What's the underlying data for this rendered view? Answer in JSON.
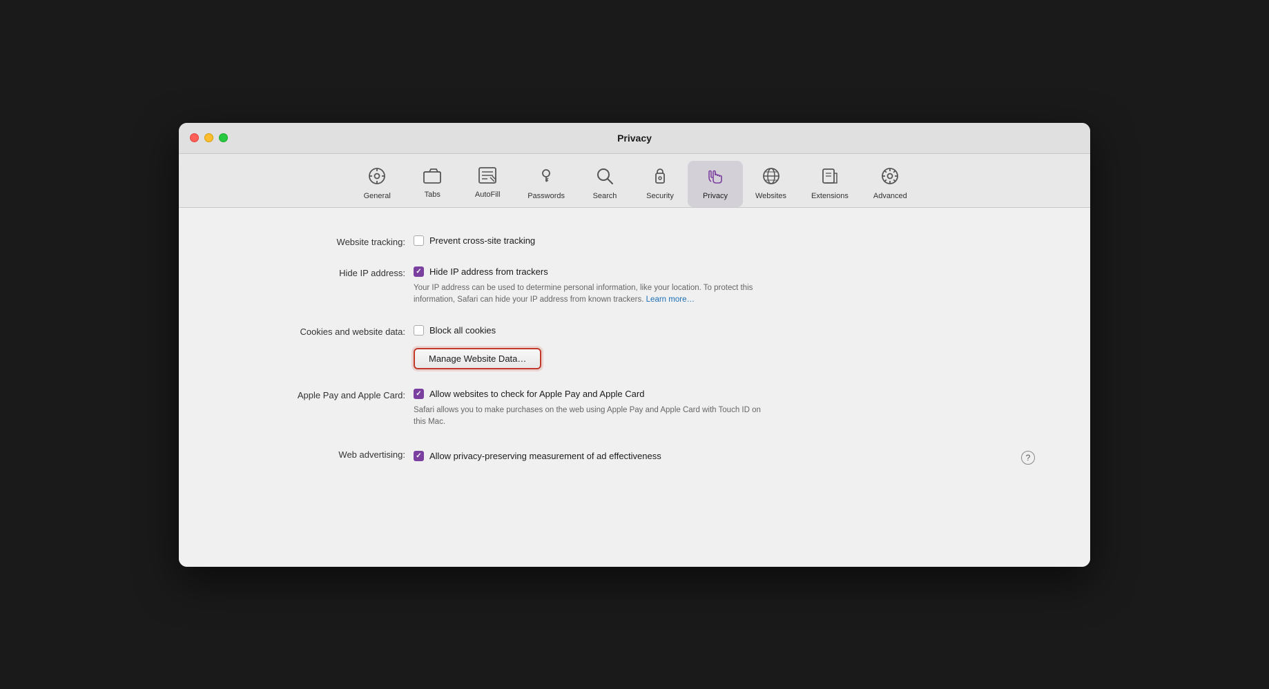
{
  "window": {
    "title": "Privacy"
  },
  "toolbar": {
    "items": [
      {
        "id": "general",
        "label": "General",
        "icon": "⚙️",
        "active": false
      },
      {
        "id": "tabs",
        "label": "Tabs",
        "icon": "🗂",
        "active": false
      },
      {
        "id": "autofill",
        "label": "AutoFill",
        "icon": "⌨️",
        "active": false
      },
      {
        "id": "passwords",
        "label": "Passwords",
        "icon": "🔑",
        "active": false
      },
      {
        "id": "search",
        "label": "Search",
        "icon": "🔍",
        "active": false
      },
      {
        "id": "security",
        "label": "Security",
        "icon": "🔒",
        "active": false
      },
      {
        "id": "privacy",
        "label": "Privacy",
        "icon": "✋",
        "active": true
      },
      {
        "id": "websites",
        "label": "Websites",
        "icon": "🌐",
        "active": false
      },
      {
        "id": "extensions",
        "label": "Extensions",
        "icon": "🔌",
        "active": false
      },
      {
        "id": "advanced",
        "label": "Advanced",
        "icon": "⚙️",
        "active": false
      }
    ]
  },
  "settings": {
    "website_tracking": {
      "label": "Website tracking:",
      "checkbox_checked": false,
      "checkbox_label": "Prevent cross-site tracking"
    },
    "hide_ip": {
      "label": "Hide IP address:",
      "checkbox_checked": true,
      "checkbox_label": "Hide IP address from trackers",
      "description": "Your IP address can be used to determine personal information, like your location. To protect this information, Safari can hide your IP address from known trackers.",
      "learn_more": "Learn more…"
    },
    "cookies": {
      "label": "Cookies and website data:",
      "checkbox_checked": false,
      "checkbox_label": "Block all cookies",
      "manage_button_label": "Manage Website Data…"
    },
    "apple_pay": {
      "label": "Apple Pay and Apple Card:",
      "checkbox_checked": true,
      "checkbox_label": "Allow websites to check for Apple Pay and Apple Card",
      "description": "Safari allows you to make purchases on the web using Apple Pay and Apple Card with Touch ID on this Mac."
    },
    "web_advertising": {
      "label": "Web advertising:",
      "checkbox_checked": true,
      "checkbox_label": "Allow privacy-preserving measurement of ad effectiveness",
      "help_label": "?"
    }
  }
}
